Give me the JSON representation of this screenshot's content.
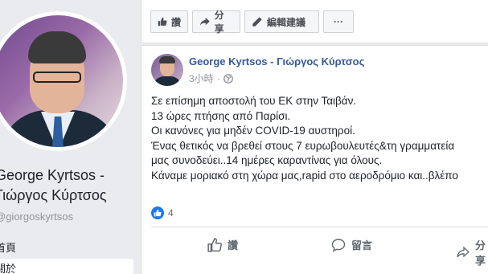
{
  "page": {
    "name": "George Kyrtsos -\nΓιώργος Κύρτσος",
    "handle": "@giorgoskyrtsos",
    "nav": [
      "首頁",
      "關於"
    ]
  },
  "top_actions": {
    "like": "讚",
    "share": "分享",
    "suggest_edit": "編輯建議",
    "more": "···"
  },
  "post": {
    "author": "George Kyrtsos - Γιώργος Κύρτσος",
    "time": "3小時",
    "lines": [
      "Σε επίσημη αποστολή του ΕΚ στην Ταιβάν.",
      "13 ώρες πτήσης από Παρίσι.",
      "Οι κανόνες για μηδέν COVID-19 αυστηροί.",
      "Ένας θετικός να βρεθεί στους 7 ευρωβουλευτές&τη γραμματεία",
      "μας συνοδεύει..14 ημέρες καραντίνας για όλους.",
      "Κάναμε μοριακό στη χώρα μας,rapid στο αεροδρόμιο και..βλέπο"
    ],
    "reaction_count": "4",
    "actions": {
      "like": "讚",
      "comment": "留言",
      "share": "分享"
    }
  },
  "colors": {
    "background": "#e9ebee",
    "link_blue": "#365899",
    "like_blue": "#1877f2"
  }
}
